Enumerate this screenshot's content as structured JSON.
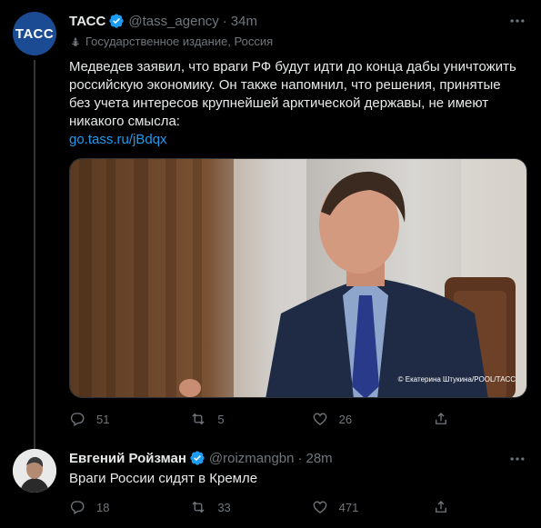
{
  "tweets": [
    {
      "author_name": "ТАСС",
      "avatar_text": "ТАСС",
      "handle": "@tass_agency",
      "separator": "·",
      "time": "34m",
      "state_label": "Государственное издание, Россия",
      "text": "Медведев заявил, что враги РФ будут идти до конца дабы уничтожить российскую экономику. Он также напомнил, что решения, принятые без учета интересов крупнейшей арктической державы, не имеют никакого смысла:",
      "link": "go.tass.ru/jBdqx",
      "photo_credit": "© Екатерина Штукина/POOL/ТАСС",
      "replies": "51",
      "retweets": "5",
      "likes": "26"
    },
    {
      "author_name": "Евгений Ройзман",
      "handle": "@roizmangbn",
      "separator": "·",
      "time": "28m",
      "text": "Враги России сидят в Кремле",
      "replies": "18",
      "retweets": "33",
      "likes": "471"
    }
  ],
  "icons": {
    "verified": "verified-badge-icon",
    "more": "more-horizontal-icon",
    "state": "state-media-icon",
    "reply": "reply-icon",
    "retweet": "retweet-icon",
    "like": "like-icon",
    "share": "share-icon"
  },
  "colors": {
    "background": "#000000",
    "text": "#e7e9ea",
    "muted": "#71767b",
    "link": "#1d9bf0",
    "verified": "#1d9bf0",
    "tass_avatar": "#1b4c93"
  }
}
